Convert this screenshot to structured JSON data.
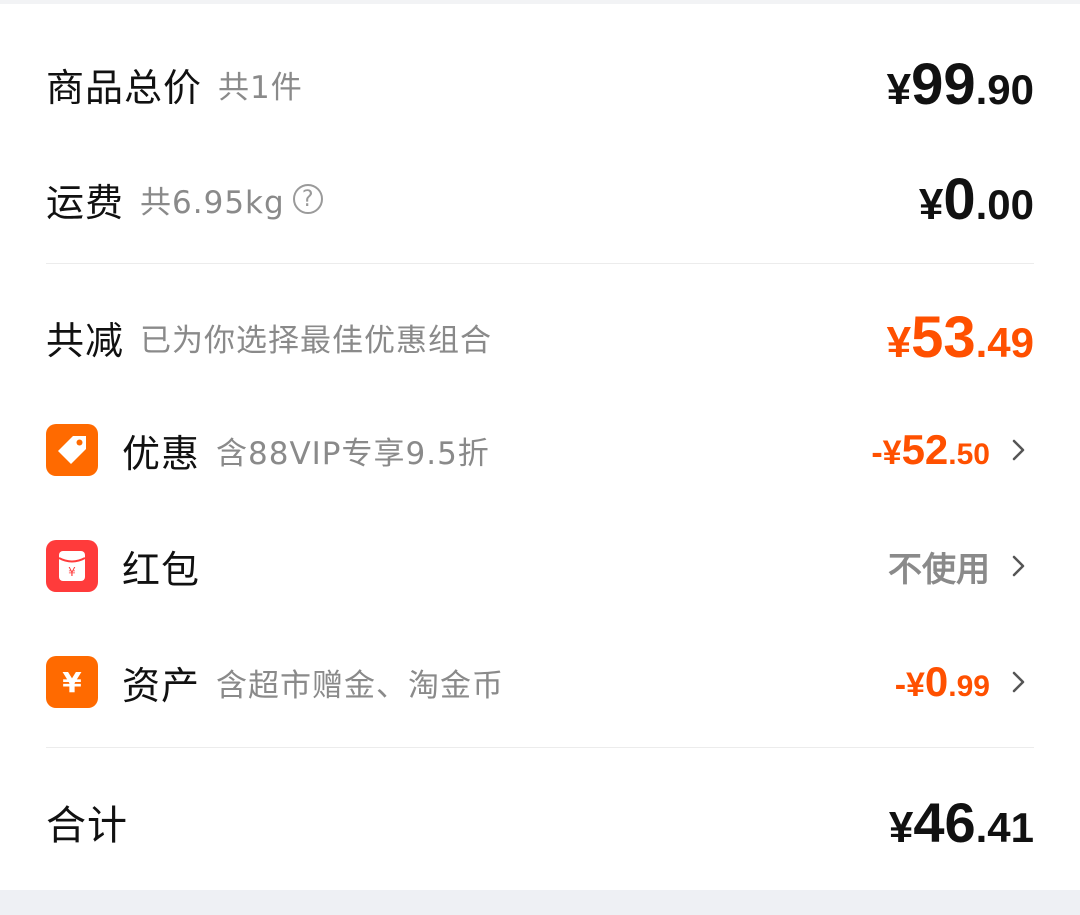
{
  "summary": {
    "goods": {
      "title": "商品总价",
      "sub": "共1件",
      "currency": "¥",
      "int": "99",
      "dec": ".90"
    },
    "shipping": {
      "title": "运费",
      "sub": "共6.95kg",
      "help_glyph": "?",
      "currency": "¥",
      "int": "0",
      "dec": ".00"
    },
    "discount_total": {
      "title": "共减",
      "sub": "已为你选择最佳优惠组合",
      "currency": "¥",
      "int": "53",
      "dec": ".49",
      "color": "#ff5000"
    },
    "items": [
      {
        "icon": "tag-icon",
        "title": "优惠",
        "sub": "含88VIP专享9.5折",
        "prefix": "-¥",
        "int": "52",
        "dec": ".50"
      },
      {
        "icon": "red-envelope-icon",
        "title": "红包",
        "sub": "",
        "value": "不使用"
      },
      {
        "icon": "yen-icon",
        "title": "资产",
        "sub": "含超市赠金、淘金币",
        "prefix": "-¥",
        "int": "0",
        "dec": ".99"
      }
    ],
    "total": {
      "title": "合计",
      "currency": "¥",
      "int": "46",
      "dec": ".41"
    }
  },
  "colors": {
    "accent": "#ff5000",
    "icon_orange": "#ff6a00",
    "icon_red": "#ff3b3b"
  }
}
